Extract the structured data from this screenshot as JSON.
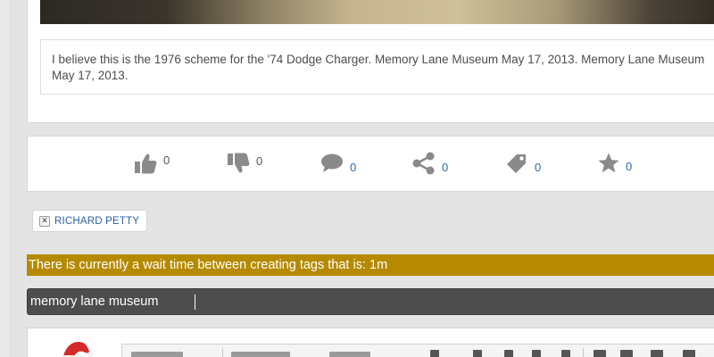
{
  "post": {
    "caption": "I believe this is the 1976 scheme for the '74 Dodge Charger. Memory Lane Museum May 17, 2013. Memory Lane Museum May 17, 2013."
  },
  "actions": {
    "like": {
      "icon": "thumbs-up-icon",
      "count": "0"
    },
    "dislike": {
      "icon": "thumbs-down-icon",
      "count": "0"
    },
    "comment": {
      "icon": "speech-bubble-icon",
      "count": "0"
    },
    "share": {
      "icon": "share-icon",
      "count": "0"
    },
    "tag": {
      "icon": "tag-icon",
      "count": "0"
    },
    "favorite": {
      "icon": "star-icon",
      "count": "0"
    }
  },
  "tags": [
    {
      "label": "RICHARD PETTY"
    }
  ],
  "tag_warning": "There is currently a wait time between creating tags that is: 1m",
  "tag_input": {
    "value": "memory lane museum"
  },
  "colors": {
    "warning_bg": "#b58a00",
    "input_bg": "#4d4d4d",
    "link_blue": "#2a6aa8",
    "icon_grey": "#8a8a8a"
  }
}
